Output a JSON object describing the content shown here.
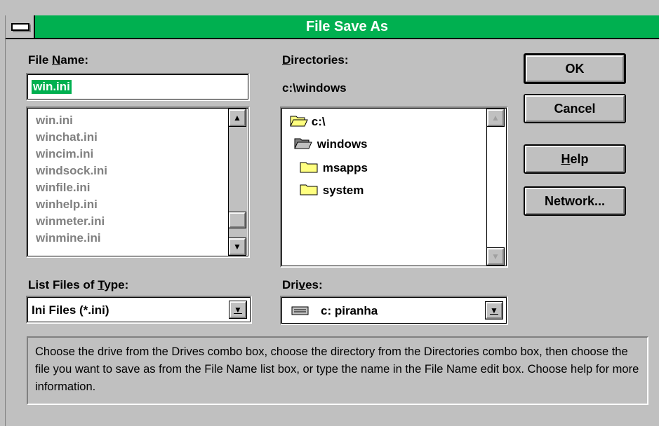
{
  "window": {
    "title": "File Save As"
  },
  "file_name": {
    "label_pre": "File ",
    "label_key": "N",
    "label_post": "ame:",
    "value": "win.ini",
    "files": [
      "win.ini",
      "winchat.ini",
      "wincim.ini",
      "windsock.ini",
      "winfile.ini",
      "winhelp.ini",
      "winmeter.ini",
      "winmine.ini"
    ]
  },
  "directories": {
    "label_key": "D",
    "label_post": "irectories:",
    "current_path": "c:\\windows",
    "items": [
      {
        "name": "c:\\",
        "icon": "open-folder-icon"
      },
      {
        "name": "windows",
        "icon": "open-folder-icon"
      },
      {
        "name": "msapps",
        "icon": "folder-icon"
      },
      {
        "name": "system",
        "icon": "folder-icon"
      }
    ]
  },
  "file_type": {
    "label_pre": "List Files of ",
    "label_key": "T",
    "label_post": "ype:",
    "selected": "Ini Files (*.ini)"
  },
  "drives": {
    "label_pre": "Dri",
    "label_key": "v",
    "label_post": "es:",
    "selected": "c: piranha",
    "icon": "hard-drive-icon"
  },
  "buttons": {
    "ok": "OK",
    "cancel": "Cancel",
    "help_key": "H",
    "help_post": "elp",
    "network": "Network..."
  },
  "hint": "Choose the drive from the Drives combo box, choose the directory from the Directories combo box, then choose the file you want to save as from the File Name list box, or type the name in the File Name edit box.  Choose help for more information.",
  "colors": {
    "title_bar": "#00b050",
    "dialog_face": "#c0c0c0",
    "selection": "#00b050",
    "folder": "#ffff80"
  }
}
